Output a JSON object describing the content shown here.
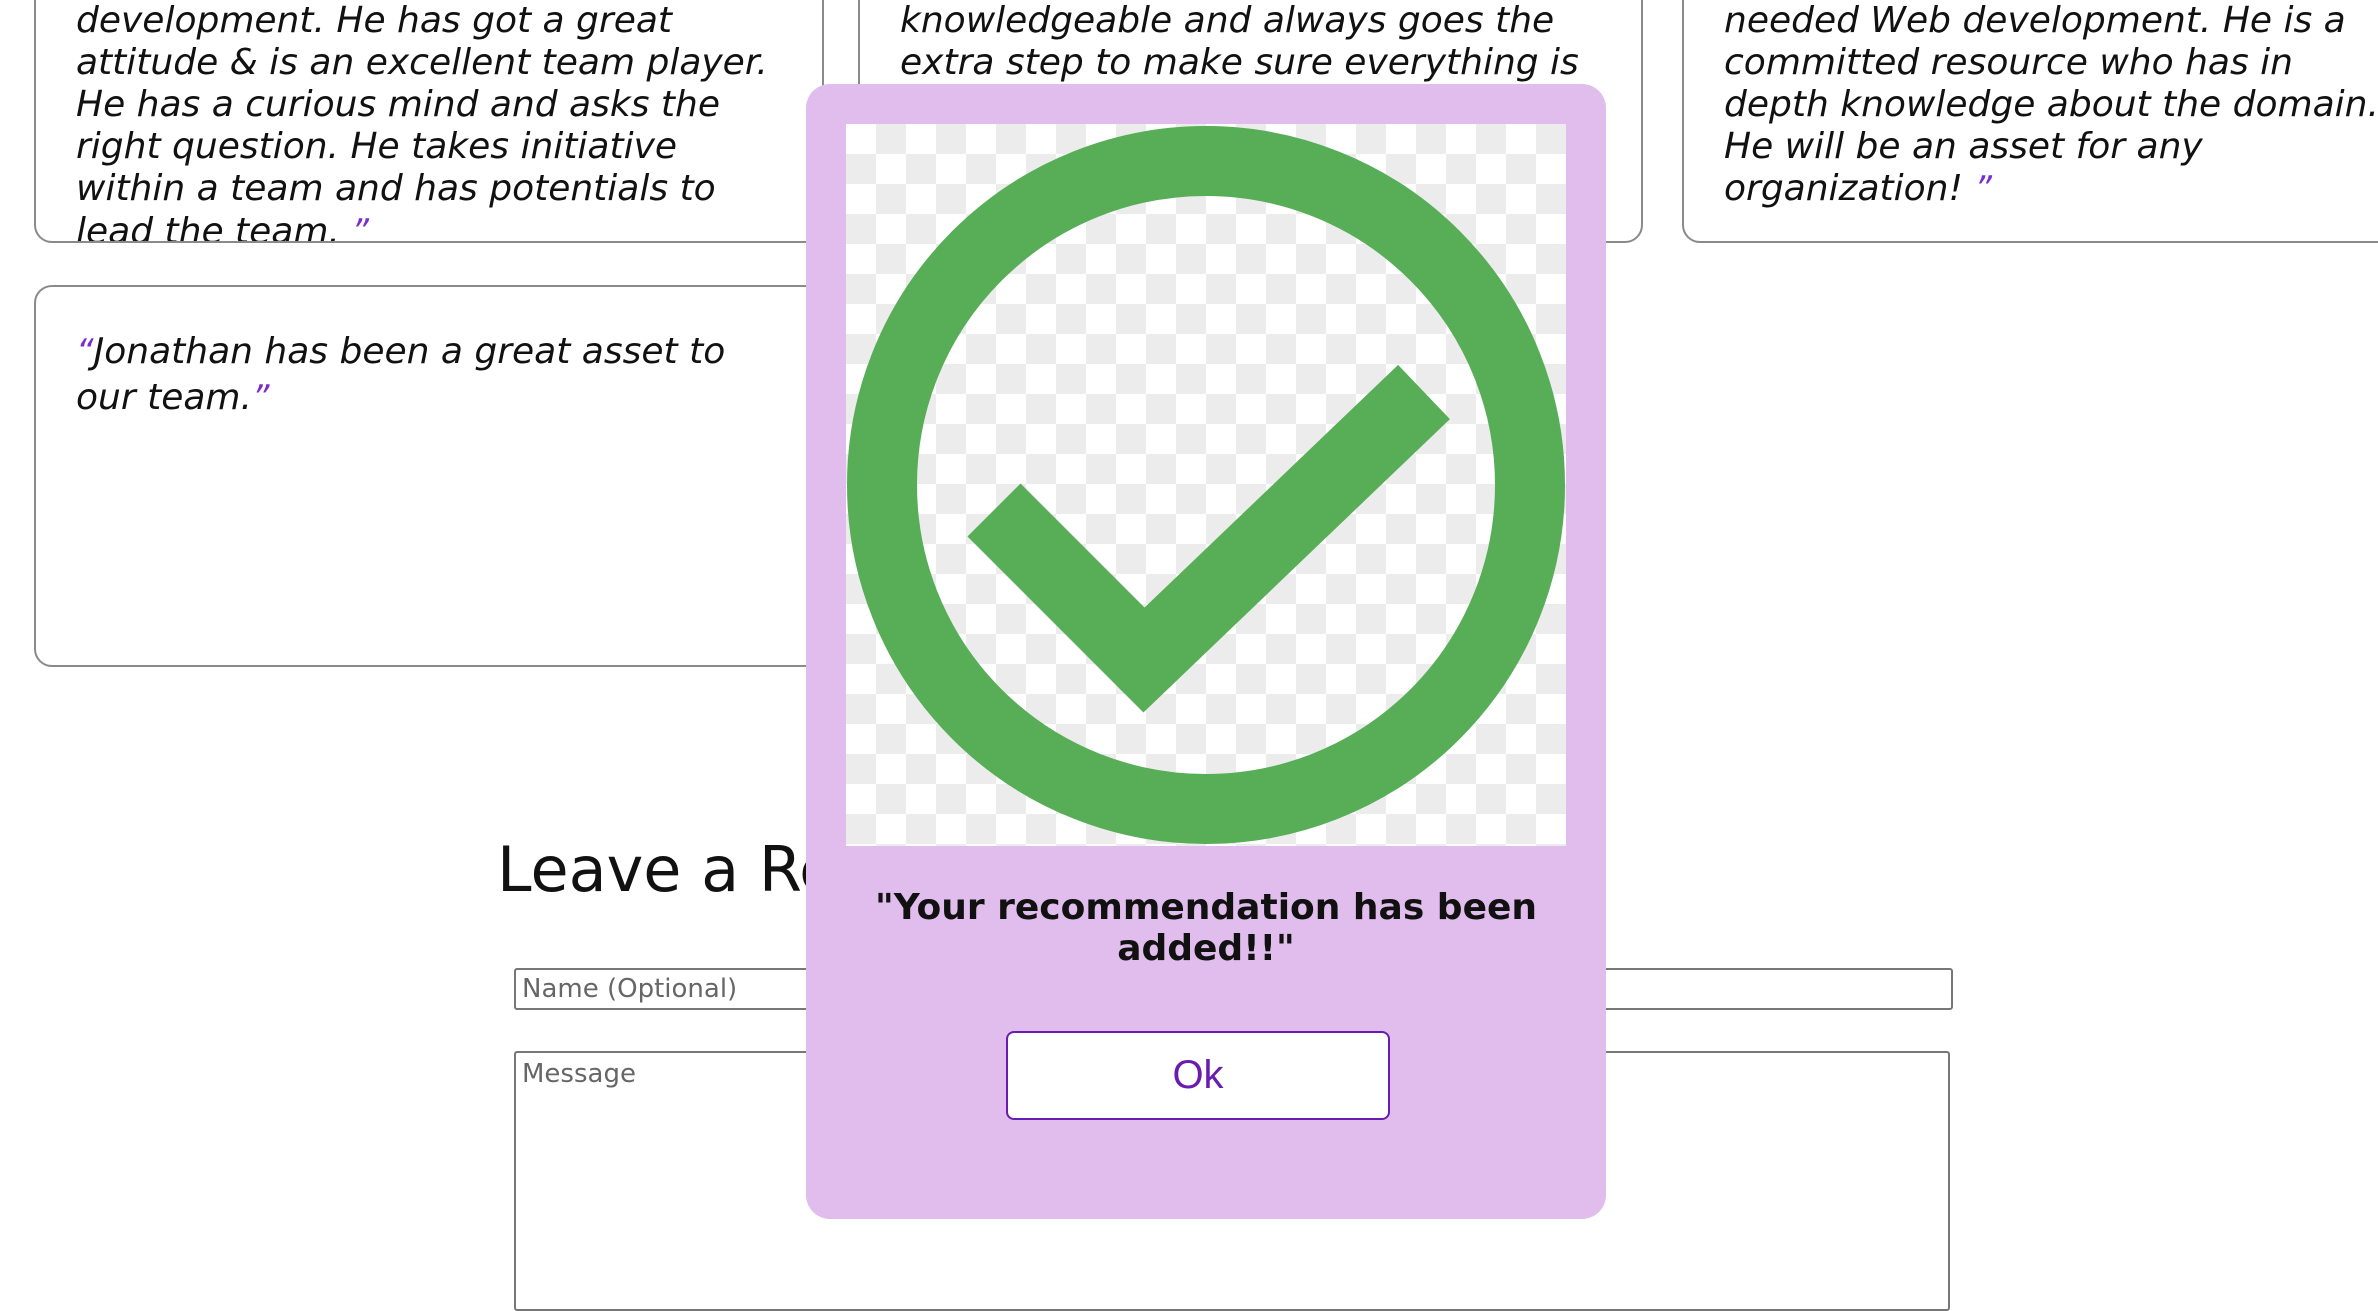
{
  "recommendations": [
    {
      "open_quote": "",
      "text": "development. He has got a great attitude & is an excellent team player. He has a curious mind and asks the right question. He takes initiative within a team and has potentials to lead the team.",
      "close_quote": "”"
    },
    {
      "open_quote": "",
      "text": "knowledgeable and always goes the extra step to make sure everything is right. For",
      "close_quote": ""
    },
    {
      "open_quote": "",
      "text": "needed Web development. He is a committed resource who has in depth knowledge about the domain. He will be an asset for any organization!",
      "close_quote": "”"
    },
    {
      "open_quote": "“",
      "text": "Jonathan has been a great asset to our team.",
      "close_quote": "”"
    }
  ],
  "form": {
    "title": "Leave a Recommendation",
    "name_placeholder": "Name (Optional)",
    "message_placeholder": "Message"
  },
  "modal": {
    "icon": "check-circle-icon",
    "message": "\"Your recommendation has been added!!\"",
    "ok_label": "Ok"
  },
  "colors": {
    "modal_background": "#e0bdec",
    "check_green": "#57ae57",
    "accent_purple": "#6a1bb0"
  }
}
